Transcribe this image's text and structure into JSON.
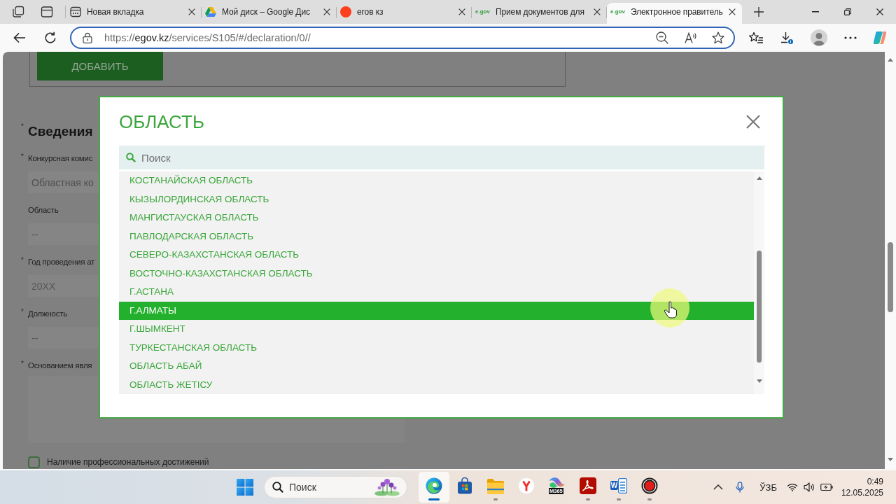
{
  "browser": {
    "tabs": [
      {
        "kind": "newtab",
        "title": "Новая вкладка",
        "selected": false
      },
      {
        "kind": "drive",
        "title": "Мой диск – Google Дис",
        "selected": false
      },
      {
        "kind": "yandex",
        "title": "егов кз",
        "selected": false
      },
      {
        "kind": "egov",
        "favicon_text": "e.gov",
        "title": "Прием документов для",
        "selected": false
      },
      {
        "kind": "egov",
        "favicon_text": "e.gov",
        "title": "Электронное правитель",
        "selected": true
      }
    ],
    "address": {
      "scheme": "https://",
      "host": "egov.kz",
      "path": "/services/S105/#/declaration/0//"
    }
  },
  "page": {
    "add_button": "ДОБАВИТЬ",
    "section": {
      "mark": "*",
      "title": "Сведения"
    },
    "fields": [
      {
        "kind": "input",
        "mark": "*",
        "label": "Конкурсная комис",
        "value": "Областная ко"
      },
      {
        "kind": "select",
        "label": "Область",
        "value": "--"
      },
      {
        "kind": "input",
        "mark": "*",
        "label": "Год проведения ат",
        "placeholder": "20XX"
      },
      {
        "kind": "select",
        "mark": "*",
        "label": "Должность",
        "value": "--"
      },
      {
        "kind": "textarea",
        "mark": "*",
        "label": "Основанием явля"
      }
    ],
    "checkbox": {
      "label": "Наличие профессиональных достижений",
      "checked": false
    }
  },
  "modal": {
    "title": "ОБЛАСТЬ",
    "search": {
      "placeholder": "Поиск"
    },
    "options": [
      {
        "label": "КОСТАНАЙСКАЯ ОБЛАСТЬ",
        "selected": false
      },
      {
        "label": "КЫЗЫЛОРДИНСКАЯ ОБЛАСТЬ",
        "selected": false
      },
      {
        "label": "МАНГИСТАУСКАЯ ОБЛАСТЬ",
        "selected": false
      },
      {
        "label": "ПАВЛОДАРСКАЯ ОБЛАСТЬ",
        "selected": false
      },
      {
        "label": "СЕВЕРО-КАЗАХСТАНСКАЯ ОБЛАСТЬ",
        "selected": false
      },
      {
        "label": "ВОСТОЧНО-КАЗАХСТАНСКАЯ ОБЛАСТЬ",
        "selected": false
      },
      {
        "label": "Г.АСТАНА",
        "selected": false
      },
      {
        "label": "Г.АЛМАТЫ",
        "selected": true
      },
      {
        "label": "Г.ШЫМКЕНТ",
        "selected": false
      },
      {
        "label": "ТУРКЕСТАНСКАЯ ОБЛАСТЬ",
        "selected": false
      },
      {
        "label": "ОБЛАСТЬ АБАЙ",
        "selected": false
      },
      {
        "label": "ОБЛАСТЬ ЖЕТІСУ",
        "selected": false
      }
    ]
  },
  "taskbar": {
    "search": {
      "placeholder": "Поиск"
    },
    "apps": [
      {
        "kind": "edge",
        "open": true,
        "selected": true
      },
      {
        "kind": "store",
        "open": false,
        "selected": false
      },
      {
        "kind": "files",
        "open": true,
        "selected": false
      },
      {
        "kind": "yandex",
        "open": false,
        "selected": false
      },
      {
        "kind": "m365",
        "badge": "M365",
        "open": false,
        "selected": false
      },
      {
        "kind": "acrobat",
        "open": true,
        "selected": false
      },
      {
        "kind": "word",
        "badge": "W",
        "open": true,
        "selected": false
      },
      {
        "kind": "recorder",
        "open": true,
        "selected": false
      }
    ],
    "tray": {
      "language": "ЎЗБ"
    },
    "clock": {
      "time": "0:49",
      "date": "12.05.2025"
    }
  }
}
